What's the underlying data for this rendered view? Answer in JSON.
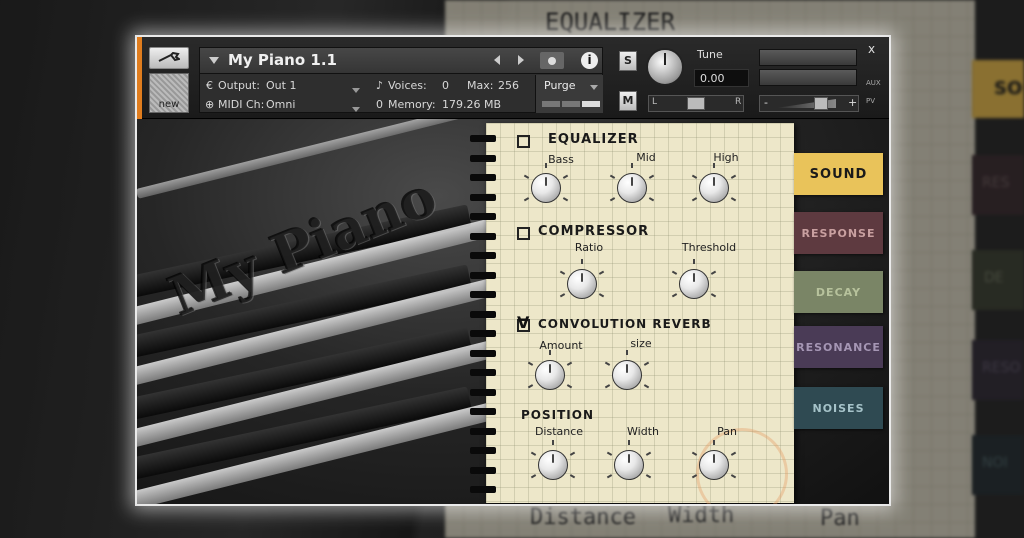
{
  "header": {
    "instrument_name": "My Piano 1.1",
    "output_label": "Output:",
    "output_value": "Out 1",
    "midi_label": "MIDI Ch:",
    "midi_value": "Omni",
    "voices_label": "Voices:",
    "voices_value": "0",
    "max_label": "Max:",
    "max_value": "256",
    "memory_label": "Memory:",
    "memory_value": "179.26 MB",
    "purge_label": "Purge",
    "tune_label": "Tune",
    "tune_value": "0.00",
    "solo_label": "S",
    "mute_label": "M",
    "pan_left": "L",
    "pan_right": "R",
    "vol_minus": "-",
    "vol_plus": "+",
    "close": "x",
    "aux_label": "AUX",
    "pv_label": "PV",
    "new_label": "new",
    "memory_prefix": "0",
    "info_glyph": "i"
  },
  "background": {
    "logo_text": "My Piano"
  },
  "notebook": {
    "equalizer": {
      "title": "EQUALIZER",
      "enabled": false,
      "knobs": [
        "Bass",
        "Mid",
        "High"
      ]
    },
    "compressor": {
      "title": "COMPRESSOR",
      "enabled": false,
      "knobs": [
        "Ratio",
        "Threshold"
      ]
    },
    "reverb": {
      "title": "CONVOLUTION REVERB",
      "enabled": true,
      "knobs": [
        "Amount",
        "size"
      ]
    },
    "position": {
      "title": "POSITION",
      "knobs": [
        "Distance",
        "Width",
        "Pan"
      ]
    }
  },
  "tabs": [
    {
      "label": "SOUND",
      "bg": "#e9c35a",
      "color": "#1a1a1a"
    },
    {
      "label": "RESPONSE",
      "bg": "#5e3a40",
      "color": "#c9a0a0"
    },
    {
      "label": "DECAY",
      "bg": "#7a8566",
      "color": "#b7c29c"
    },
    {
      "label": "RESONANCE",
      "bg": "#4a3b56",
      "color": "#a596b4"
    },
    {
      "label": "NOISES",
      "bg": "#2f4a52",
      "color": "#a6c3c9"
    }
  ],
  "echo": {
    "equalizer": "EQUALIZER",
    "distance": "Distance",
    "width": "Width",
    "pan": "Pan",
    "tab_so": "SO",
    "tab_res": "RES",
    "tab_de": "DE",
    "tab_reso": "RESO",
    "tab_noi": "NOI"
  }
}
